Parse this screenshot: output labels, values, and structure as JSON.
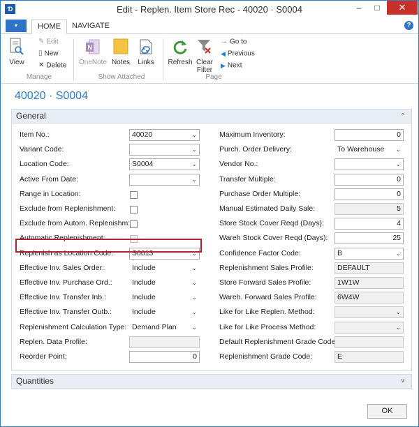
{
  "window": {
    "title": "Edit - Replen. Item Store Rec - 40020 · S0004",
    "app_icon": "Ɗ",
    "minimize": "–",
    "maximize": "□",
    "close": "✕"
  },
  "tabs": {
    "app_menu": "▾",
    "home": "HOME",
    "navigate": "NAVIGATE",
    "help": "?"
  },
  "ribbon": {
    "manage": {
      "label": "Manage",
      "view": "View",
      "edit": "Edit",
      "new": "New",
      "delete": "Delete"
    },
    "show_attached": {
      "label": "Show Attached",
      "onenote": "OneNote",
      "notes": "Notes",
      "links": "Links"
    },
    "page": {
      "label": "Page",
      "refresh": "Refresh",
      "clear_filter_1": "Clear",
      "clear_filter_2": "Filter",
      "goto": "Go to",
      "previous": "Previous",
      "next": "Next"
    }
  },
  "page_title": "40020 · S0004",
  "general": {
    "title": "General",
    "chevron": "^",
    "left_fields": [
      {
        "label": "Item No.:",
        "value": "40020",
        "type": "dropdown"
      },
      {
        "label": "Variant Code:",
        "value": "",
        "type": "dropdown"
      },
      {
        "label": "Location Code:",
        "value": "S0004",
        "type": "dropdown"
      },
      {
        "label": "Active From Date:",
        "value": "",
        "type": "dropdown"
      },
      {
        "label": "Range in Location:",
        "value": false,
        "type": "checkbox"
      },
      {
        "label": "Exclude from Replenishment:",
        "value": false,
        "type": "checkbox"
      },
      {
        "label": "Exclude from Autom. Replenishm:",
        "value": false,
        "type": "checkbox"
      },
      {
        "label": "Automatic Replenishment:",
        "value": false,
        "type": "checkbox-disabled"
      },
      {
        "label": "Replenish as Location Code:",
        "value": "S0013",
        "type": "dropdown"
      },
      {
        "label": "Effective Inv. Sales Order:",
        "value": "Include",
        "type": "select"
      },
      {
        "label": "Effective Inv. Purchase Ord.:",
        "value": "Include",
        "type": "select"
      },
      {
        "label": "Effective Inv. Transfer Inb.:",
        "value": "Include",
        "type": "select"
      },
      {
        "label": "Effective Inv. Transfer Outb.:",
        "value": "Include",
        "type": "select"
      },
      {
        "label": "Replenishment Calculation Type:",
        "value": "Demand Plan",
        "type": "select"
      },
      {
        "label": "Replen. Data Profile:",
        "value": "",
        "type": "readonly"
      },
      {
        "label": "Reorder Point:",
        "value": "0",
        "type": "number"
      }
    ],
    "right_fields": [
      {
        "label": "Maximum Inventory:",
        "value": "0",
        "type": "number"
      },
      {
        "label": "Purch. Order Delivery:",
        "value": "To Warehouse",
        "type": "select"
      },
      {
        "label": "Vendor No.:",
        "value": "",
        "type": "dropdown"
      },
      {
        "label": "Transfer Multiple:",
        "value": "0",
        "type": "number"
      },
      {
        "label": "Purchase Order Multiple:",
        "value": "0",
        "type": "number"
      },
      {
        "label": "Manual Estimated Daily Sale:",
        "value": "5",
        "type": "number-readonly"
      },
      {
        "label": "Store Stock Cover Reqd (Days):",
        "value": "4",
        "type": "number"
      },
      {
        "label": "Wareh Stock Cover Reqd (Days):",
        "value": "25",
        "type": "number"
      },
      {
        "label": "Confidence Factor Code:",
        "value": "B",
        "type": "dropdown"
      },
      {
        "label": "Replenishment Sales Profile:",
        "value": "DEFAULT",
        "type": "readonly"
      },
      {
        "label": "Store Forward Sales Profile:",
        "value": "1W1W",
        "type": "readonly"
      },
      {
        "label": "Wareh. Forward Sales Profile:",
        "value": "6W4W",
        "type": "readonly"
      },
      {
        "label": "Like for Like Replen. Method:",
        "value": "",
        "type": "select-readonly"
      },
      {
        "label": "Like for Like Process Method:",
        "value": "",
        "type": "select-readonly"
      },
      {
        "label": "Default Replenishment Grade Code:",
        "value": "",
        "type": "readonly"
      },
      {
        "label": "Replenishment Grade Code:",
        "value": "E",
        "type": "readonly"
      }
    ]
  },
  "quantities": {
    "title": "Quantities",
    "chevron": "v"
  },
  "ok_button": "OK",
  "colors": {
    "accent": "#2d7dc8",
    "highlight_border": "#b8202c",
    "close_button": "#c7312b"
  }
}
